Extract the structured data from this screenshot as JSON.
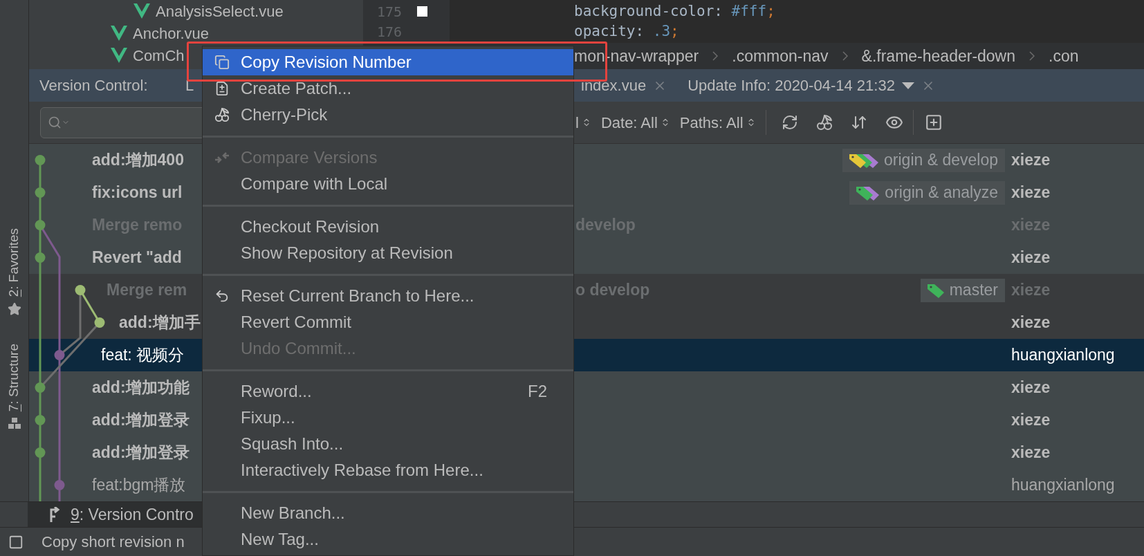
{
  "left_strip": [
    {
      "mnemonic": "2",
      "label": ": Favorites"
    },
    {
      "mnemonic": "7",
      "label": ": Structure"
    }
  ],
  "project_tree": [
    {
      "name": "AnalysisSelect.vue"
    },
    {
      "name": "Anchor.vue"
    },
    {
      "name": "ComCh"
    }
  ],
  "editor": {
    "lines": [
      {
        "number": "175",
        "marker": true,
        "code": [
          {
            "text": "background-color: ",
            "kind": "plain"
          },
          {
            "text": "#fff",
            "kind": "value"
          },
          {
            "text": ";",
            "kind": "punct"
          }
        ]
      },
      {
        "number": "176",
        "marker": false,
        "code": [
          {
            "text": "opacity: ",
            "kind": "plain"
          },
          {
            "text": ".3",
            "kind": "value"
          },
          {
            "text": ";",
            "kind": "punct"
          }
        ]
      }
    ],
    "breadcrumbs": [
      "mon-nav-wrapper",
      ".common-nav",
      "&.frame-header-down",
      ".con"
    ]
  },
  "version_control": {
    "title": "Version Control:",
    "tabs": [
      {
        "label": "L"
      },
      {
        "label": "index.vue",
        "closable": true,
        "dropdown": false
      },
      {
        "label": "Update Info: 2020-04-14 21:32",
        "closable": true,
        "dropdown": true
      }
    ]
  },
  "toolbar": {
    "filters": [
      "l",
      "Date: All",
      "Paths: All"
    ]
  },
  "rows": [
    {
      "message": "add:增加400",
      "bold": true,
      "greyed": false,
      "selected": false,
      "on_current_branch": true,
      "badge": {
        "label": "origin & develop",
        "tags": [
          {
            "color": "#e5c739"
          },
          {
            "color": "#3fb35a"
          },
          {
            "color": "#a87bd0"
          }
        ]
      },
      "author": "xieze"
    },
    {
      "message": "fix:icons url",
      "bold": true,
      "greyed": false,
      "selected": false,
      "on_current_branch": true,
      "badge": {
        "label": "origin & analyze",
        "tags": [
          {
            "color": "#3fb35a"
          },
          {
            "color": "#a87bd0"
          }
        ]
      },
      "author": "xieze"
    },
    {
      "message": "Merge remo",
      "tail": "develop",
      "bold": true,
      "greyed": true,
      "selected": false,
      "on_current_branch": true,
      "author": "xieze"
    },
    {
      "message": "Revert \"add",
      "bold": true,
      "greyed": false,
      "selected": false,
      "on_current_branch": true,
      "author": "xieze"
    },
    {
      "message": "Merge rem",
      "tail": "o develop",
      "bold": true,
      "greyed": true,
      "selected": false,
      "on_current_branch": false,
      "badge": {
        "label": "master",
        "tags": [
          {
            "color": "#3fb35a"
          }
        ]
      },
      "author": "xieze"
    },
    {
      "message": "add:增加手",
      "bold": true,
      "greyed": false,
      "selected": false,
      "on_current_branch": false,
      "author": "xieze"
    },
    {
      "message": "feat: 视频分",
      "bold": false,
      "greyed": false,
      "selected": true,
      "author": "huangxianlong"
    },
    {
      "message": "add:增加功能",
      "bold": true,
      "greyed": false,
      "selected": false,
      "on_current_branch": true,
      "author": "xieze"
    },
    {
      "message": "add:增加登录",
      "bold": true,
      "greyed": false,
      "selected": false,
      "on_current_branch": true,
      "author": "xieze"
    },
    {
      "message": "add:增加登录",
      "bold": true,
      "greyed": false,
      "selected": false,
      "on_current_branch": true,
      "author": "xieze"
    },
    {
      "message": "feat:bgm播放",
      "bold": false,
      "greyed": false,
      "selected": false,
      "on_current_branch": true,
      "author": "huangxianlong"
    }
  ],
  "bottom_tabs": [
    {
      "mnemonic": "9",
      "label": ": Version Contro",
      "selected": true
    }
  ],
  "status_bar": {
    "text": "Copy short revision n"
  },
  "context_menu": [
    {
      "kind": "item",
      "label": "Copy Revision Number",
      "selected": true,
      "disabled": false
    },
    {
      "kind": "item",
      "label": "Create Patch...",
      "selected": false,
      "disabled": false
    },
    {
      "kind": "item",
      "label": "Cherry-Pick",
      "selected": false,
      "disabled": false
    },
    {
      "kind": "separator"
    },
    {
      "kind": "item",
      "label": "Compare Versions",
      "selected": false,
      "disabled": true
    },
    {
      "kind": "item",
      "label": "Compare with Local",
      "selected": false,
      "disabled": false
    },
    {
      "kind": "separator"
    },
    {
      "kind": "item",
      "label": "Checkout Revision",
      "selected": false,
      "disabled": false
    },
    {
      "kind": "item",
      "label": "Show Repository at Revision",
      "selected": false,
      "disabled": false
    },
    {
      "kind": "separator"
    },
    {
      "kind": "item",
      "label": "Reset Current Branch to Here...",
      "selected": false,
      "disabled": false
    },
    {
      "kind": "item",
      "label": "Revert Commit",
      "selected": false,
      "disabled": false
    },
    {
      "kind": "item",
      "label": "Undo Commit...",
      "selected": false,
      "disabled": true
    },
    {
      "kind": "separator"
    },
    {
      "kind": "item",
      "label": "Reword...",
      "shortcut": "F2",
      "selected": false,
      "disabled": false
    },
    {
      "kind": "item",
      "label": "Fixup...",
      "selected": false,
      "disabled": false
    },
    {
      "kind": "item",
      "label": "Squash Into...",
      "selected": false,
      "disabled": false
    },
    {
      "kind": "item",
      "label": "Interactively Rebase from Here...",
      "selected": false,
      "disabled": false
    },
    {
      "kind": "separator"
    },
    {
      "kind": "item",
      "label": "New Branch...",
      "selected": false,
      "disabled": false
    },
    {
      "kind": "item",
      "label": "New Tag...",
      "selected": false,
      "disabled": false
    }
  ]
}
